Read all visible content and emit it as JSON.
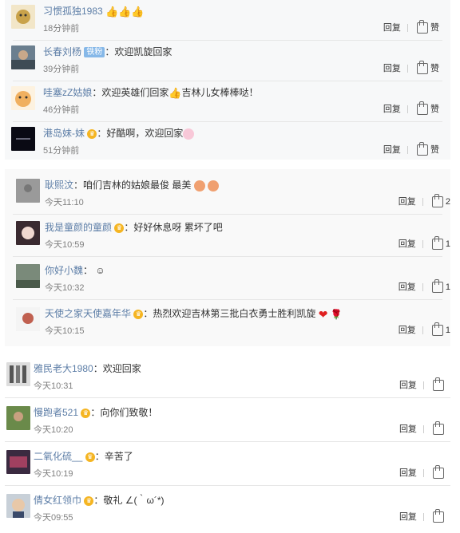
{
  "actions": {
    "reply": "回复",
    "like": "赞"
  },
  "section1": [
    {
      "name": "习惯孤独1983",
      "text": "",
      "emoji": [
        "thumbs-up",
        "thumbs-up",
        "thumbs-up"
      ],
      "time": "18分钟前"
    },
    {
      "name": "长春刘杨",
      "badge": "铁粉",
      "text": "：欢迎凯旋回家",
      "time": "39分钟前"
    },
    {
      "name": "哇塞zZ姑娘",
      "text": "：欢迎英雄们回家",
      "text2": "吉林儿女棒棒哒！",
      "time": "46分钟前"
    },
    {
      "name": "港岛妹-妹",
      "text": "：好酷啊，欢迎回家",
      "time": "51分钟前"
    }
  ],
  "section2": [
    {
      "name": "耿熙汶",
      "text": "：咱们吉林的姑娘最俊 最美",
      "time": "今天11:10",
      "likes": "2"
    },
    {
      "name": "我是童颜的童颜",
      "text": "：好好休息呀 累坏了吧",
      "time": "今天10:59",
      "likes": "1"
    },
    {
      "name": "你好小魏",
      "text": "：",
      "time": "今天10:32",
      "likes": "1"
    },
    {
      "name": "天使之家天使嘉年华",
      "text": "：热烈欢迎吉林第三批白衣勇士胜利凯旋",
      "time": "今天10:15",
      "likes": "1"
    }
  ],
  "section3": [
    {
      "name": "雅民老大1980",
      "text": "：欢迎回家",
      "time": "今天10:31"
    },
    {
      "name": "慢跑者521",
      "text": "：向你们致敬！",
      "time": "今天10:20"
    },
    {
      "name": "二氧化硫__",
      "text": "：辛苦了",
      "time": "今天10:19"
    },
    {
      "name": "倩女红领巾",
      "text": "：敬礼 ∠(｀ω´*)",
      "time": "今天09:55"
    }
  ],
  "colors": {
    "name_orange": "#eb7350",
    "name_blue": "#5d7ea7",
    "vip": "#f5b522"
  }
}
